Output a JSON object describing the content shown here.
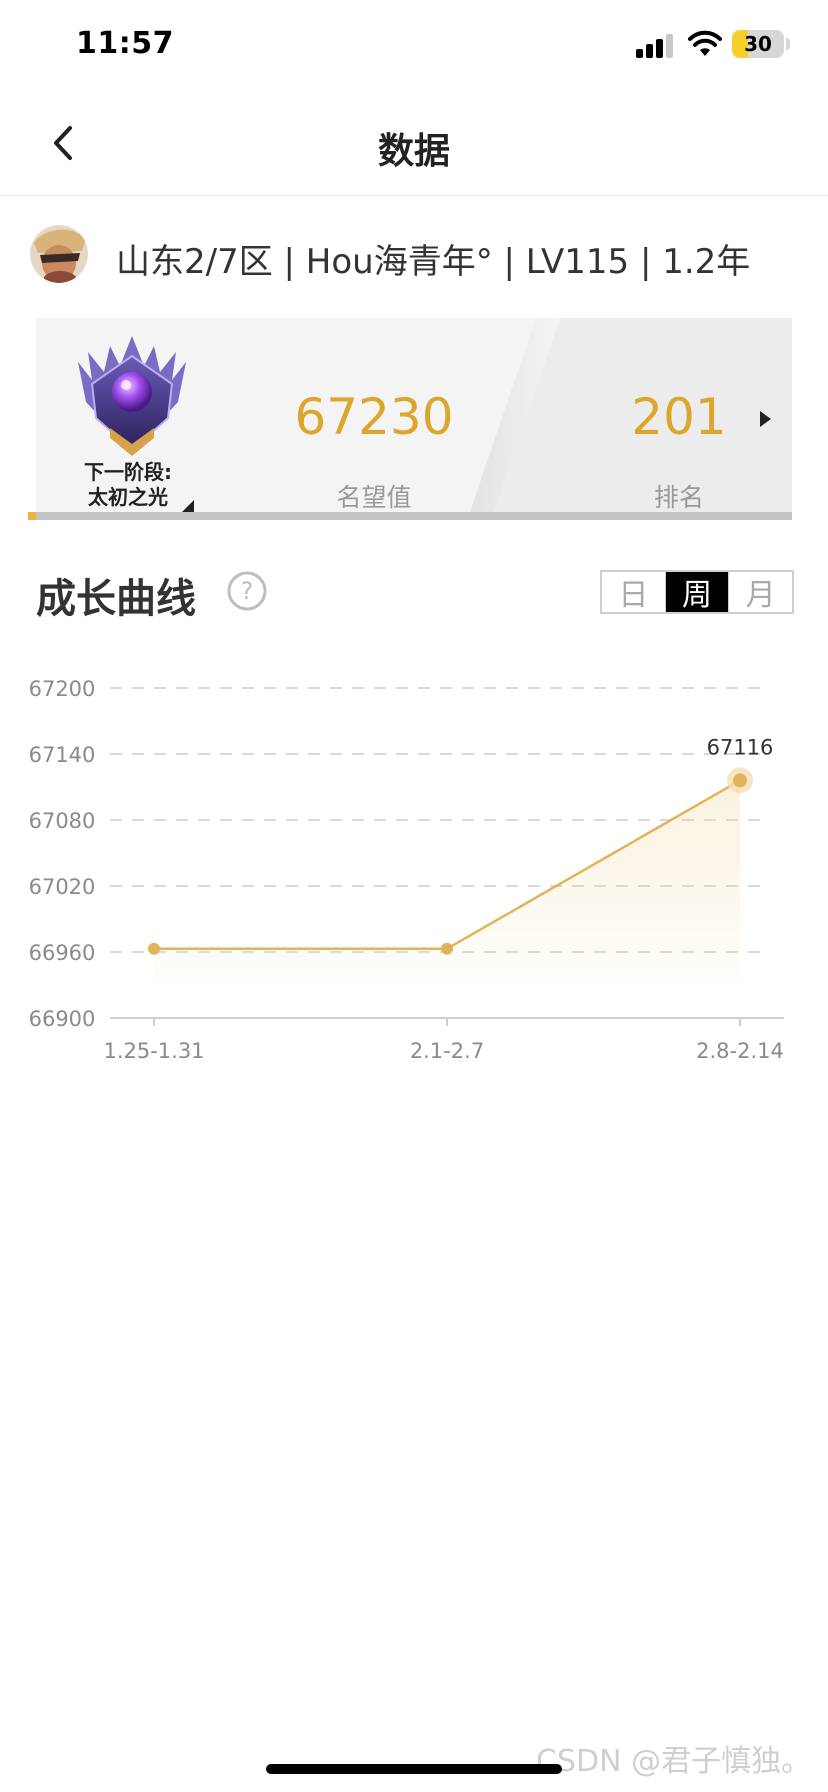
{
  "status_bar": {
    "time": "11:57",
    "battery_level": "30",
    "icons": [
      "signal-icon",
      "wifi-icon",
      "battery-icon"
    ]
  },
  "nav": {
    "title": "数据",
    "back_icon": "chevron-left-icon"
  },
  "user": {
    "info": "山东2/7区 | Hou海青年° | LV115 | 1.2年"
  },
  "rank_card": {
    "next_stage_label": "下一阶段:",
    "next_stage_name": "太初之光",
    "reputation_value": "67230",
    "reputation_label": "名望值",
    "rank_value": "201",
    "rank_label": "排名",
    "progress_fraction": 0.01,
    "colors": {
      "accent": "#dba62b",
      "progress": "#f0b43a"
    }
  },
  "growth": {
    "title": "成长曲线",
    "help_icon": "question-circle-icon",
    "periods": [
      "日",
      "周",
      "月"
    ],
    "active_period": "周"
  },
  "chart_data": {
    "type": "line",
    "categories": [
      "1.25-1.31",
      "2.1-2.7",
      "2.8-2.14"
    ],
    "series": [
      {
        "values": [
          66963,
          66963,
          67116
        ]
      }
    ],
    "ylim": [
      66900,
      67200
    ],
    "yticks": [
      "67200",
      "67140",
      "67080",
      "67020",
      "66960",
      "66900"
    ],
    "annotations": [
      {
        "category": "2.8-2.14",
        "label": "67116"
      }
    ],
    "grid": true,
    "color": "#dfb45a"
  },
  "watermark": "CSDN @君子慎独。"
}
